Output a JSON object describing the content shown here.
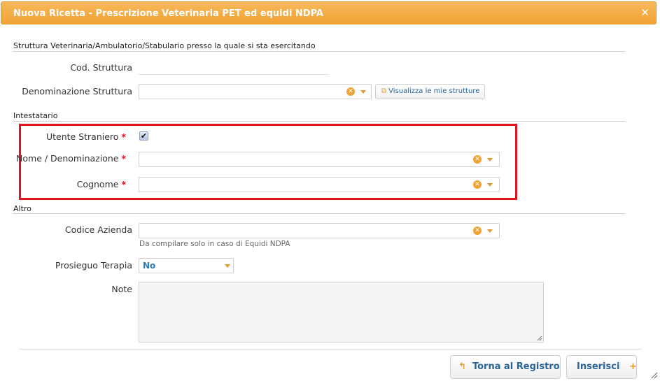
{
  "dialog": {
    "title": "Nuova Ricetta - Prescrizione Veterinaria PET ed equidi NDPA",
    "close_icon": "close-icon"
  },
  "sections": {
    "struttura": "Struttura Veterinaria/Ambulatorio/Stabulario presso la quale si sta esercitando",
    "intestatario": "Intestatario",
    "altro": "Altro"
  },
  "fields": {
    "cod_struttura": {
      "label": "Cod. Struttura",
      "value": ""
    },
    "denominazione_struttura": {
      "label": "Denominazione Struttura",
      "value": ""
    },
    "visualizza_strutture": {
      "label": "Visualizza le mie strutture",
      "icon": "external-window-icon"
    },
    "utente_straniero": {
      "label": "Utente Straniero",
      "required_mark": "*",
      "checked": true
    },
    "nome_denominazione": {
      "label": "Nome / Denominazione",
      "required_mark": "*",
      "value": ""
    },
    "cognome": {
      "label": "Cognome",
      "required_mark": "*",
      "value": ""
    },
    "codice_azienda": {
      "label": "Codice Azienda",
      "value": "",
      "hint": "Da compilare solo in caso di Equidi NDPA"
    },
    "prosieguo_terapia": {
      "label": "Prosieguo Terapia",
      "value": "No"
    },
    "note": {
      "label": "Note",
      "value": ""
    }
  },
  "buttons": {
    "torna": {
      "label": "Torna al Registro",
      "icon": "back-arrow-icon"
    },
    "inserisci": {
      "label": "Inserisci",
      "icon": "plus-icon"
    }
  },
  "colors": {
    "titlebar": "#f2a335",
    "highlight_box": "#e0151f",
    "required": "#d9121b",
    "accent_icon": "#e59a2e",
    "link_text": "#2a6496"
  }
}
